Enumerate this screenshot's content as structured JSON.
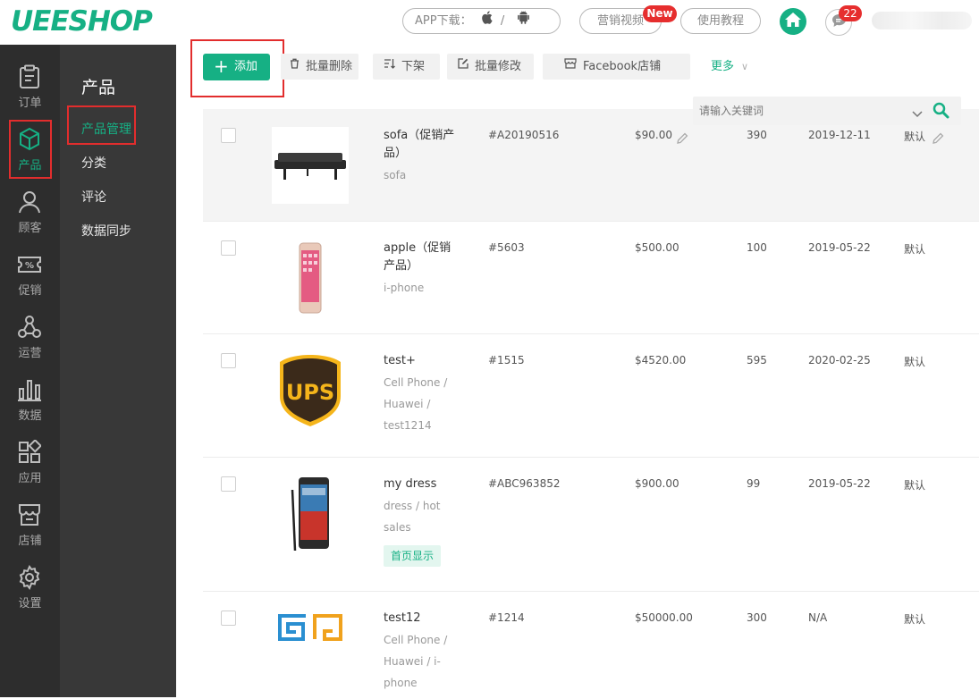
{
  "header": {
    "logo": "UEESHOP",
    "app_download": "APP下载：",
    "app_sep": "/",
    "marketing_video": "营销视频",
    "new_badge": "New",
    "tutorial": "使用教程",
    "message_count": "22",
    "colors": {
      "brand": "#16b084",
      "badge": "#e62e2e"
    }
  },
  "sidebar": {
    "items": [
      {
        "label": "订单",
        "icon": "clipboard-icon"
      },
      {
        "label": "产品",
        "icon": "cube-icon",
        "active": true
      },
      {
        "label": "顾客",
        "icon": "user-icon"
      },
      {
        "label": "促销",
        "icon": "percent-ticket-icon"
      },
      {
        "label": "运营",
        "icon": "network-icon"
      },
      {
        "label": "数据",
        "icon": "bar-chart-icon"
      },
      {
        "label": "应用",
        "icon": "apps-icon"
      },
      {
        "label": "店铺",
        "icon": "store-icon"
      },
      {
        "label": "设置",
        "icon": "gear-icon"
      }
    ]
  },
  "subnav": {
    "title": "产品",
    "items": [
      {
        "label": "产品管理",
        "active": true
      },
      {
        "label": "分类"
      },
      {
        "label": "评论"
      },
      {
        "label": "数据同步"
      }
    ]
  },
  "toolbar": {
    "add": "添加",
    "batch_delete": "批量删除",
    "unlist": "下架",
    "batch_edit": "批量修改",
    "facebook_store": "Facebook店铺",
    "more": "更多"
  },
  "search": {
    "placeholder": "请输入关键词"
  },
  "products": [
    {
      "name": "sofa（促销产品）",
      "category": "sofa",
      "sku": "#A20190516",
      "price": "$90.00",
      "qty": "390",
      "date": "2019-12-11",
      "status": "默认",
      "image": "sofa-image"
    },
    {
      "name": "apple（促销产品）",
      "category": "i-phone",
      "sku": "#5603",
      "price": "$500.00",
      "qty": "100",
      "date": "2019-05-22",
      "status": "默认",
      "image": "phone-image"
    },
    {
      "name": "test+",
      "category": "Cell Phone / Huawei / test1214",
      "sku": "#1515",
      "price": "$4520.00",
      "qty": "595",
      "date": "2020-02-25",
      "status": "默认",
      "image": "ups-logo-image"
    },
    {
      "name": "my dress",
      "category": "dress / hot sales",
      "tag": "首页显示",
      "sku": "#ABC963852",
      "price": "$900.00",
      "qty": "99",
      "date": "2019-05-22",
      "status": "默认",
      "image": "samsung-phone-image"
    },
    {
      "name": "test12",
      "category": "Cell Phone / Huawei / i-phone",
      "sku": "#1214",
      "price": "$50000.00",
      "qty": "300",
      "date": "N/A",
      "status": "默认",
      "image": "spiral-logo-image"
    }
  ]
}
